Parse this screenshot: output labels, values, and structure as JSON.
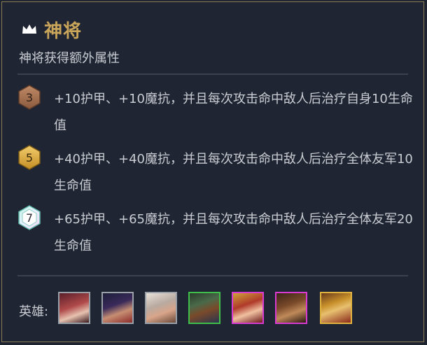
{
  "trait": {
    "name": "神将",
    "icon": "crown-icon",
    "description": "神将获得额外属性"
  },
  "tiers": [
    {
      "count": "3",
      "tier": "bronze",
      "text": "+10护甲、+10魔抗，并且每次攻击命中敌人后治疗自身10生命值"
    },
    {
      "count": "5",
      "tier": "gold",
      "text": "+40护甲、+40魔抗，并且每次攻击命中敌人后治疗全体友军10生命值"
    },
    {
      "count": "7",
      "tier": "prismatic",
      "text": "+65护甲、+65魔抗，并且每次攻击命中敌人后治疗全体友军20生命值"
    }
  ],
  "heroes_label": "英雄:",
  "heroes": [
    {
      "icon": "hero-portrait-1",
      "border": "#9aa0a8"
    },
    {
      "icon": "hero-portrait-2",
      "border": "#9aa0a8"
    },
    {
      "icon": "hero-portrait-3",
      "border": "#9aa0a8"
    },
    {
      "icon": "hero-portrait-4",
      "border": "#3fbf4a"
    },
    {
      "icon": "hero-portrait-5",
      "border": "#d73bd2"
    },
    {
      "icon": "hero-portrait-6",
      "border": "#d73bd2"
    },
    {
      "icon": "hero-portrait-7",
      "border": "#e0b340"
    }
  ],
  "colors": {
    "accent": "#c9a55a",
    "text": "#c9ccd2",
    "background": "#1f2532"
  }
}
